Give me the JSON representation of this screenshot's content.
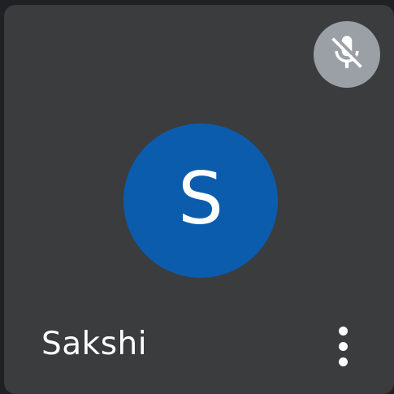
{
  "participant": {
    "name": "Sakshi",
    "initial": "S",
    "avatar_color": "#0b5cad",
    "muted": true
  },
  "icons": {
    "mute_status": "mic-off-icon",
    "more_options": "more-vert-icon"
  },
  "colors": {
    "tile_background": "#3b3c3e",
    "mute_badge_background": "#9aa0a6",
    "text": "#ffffff"
  }
}
